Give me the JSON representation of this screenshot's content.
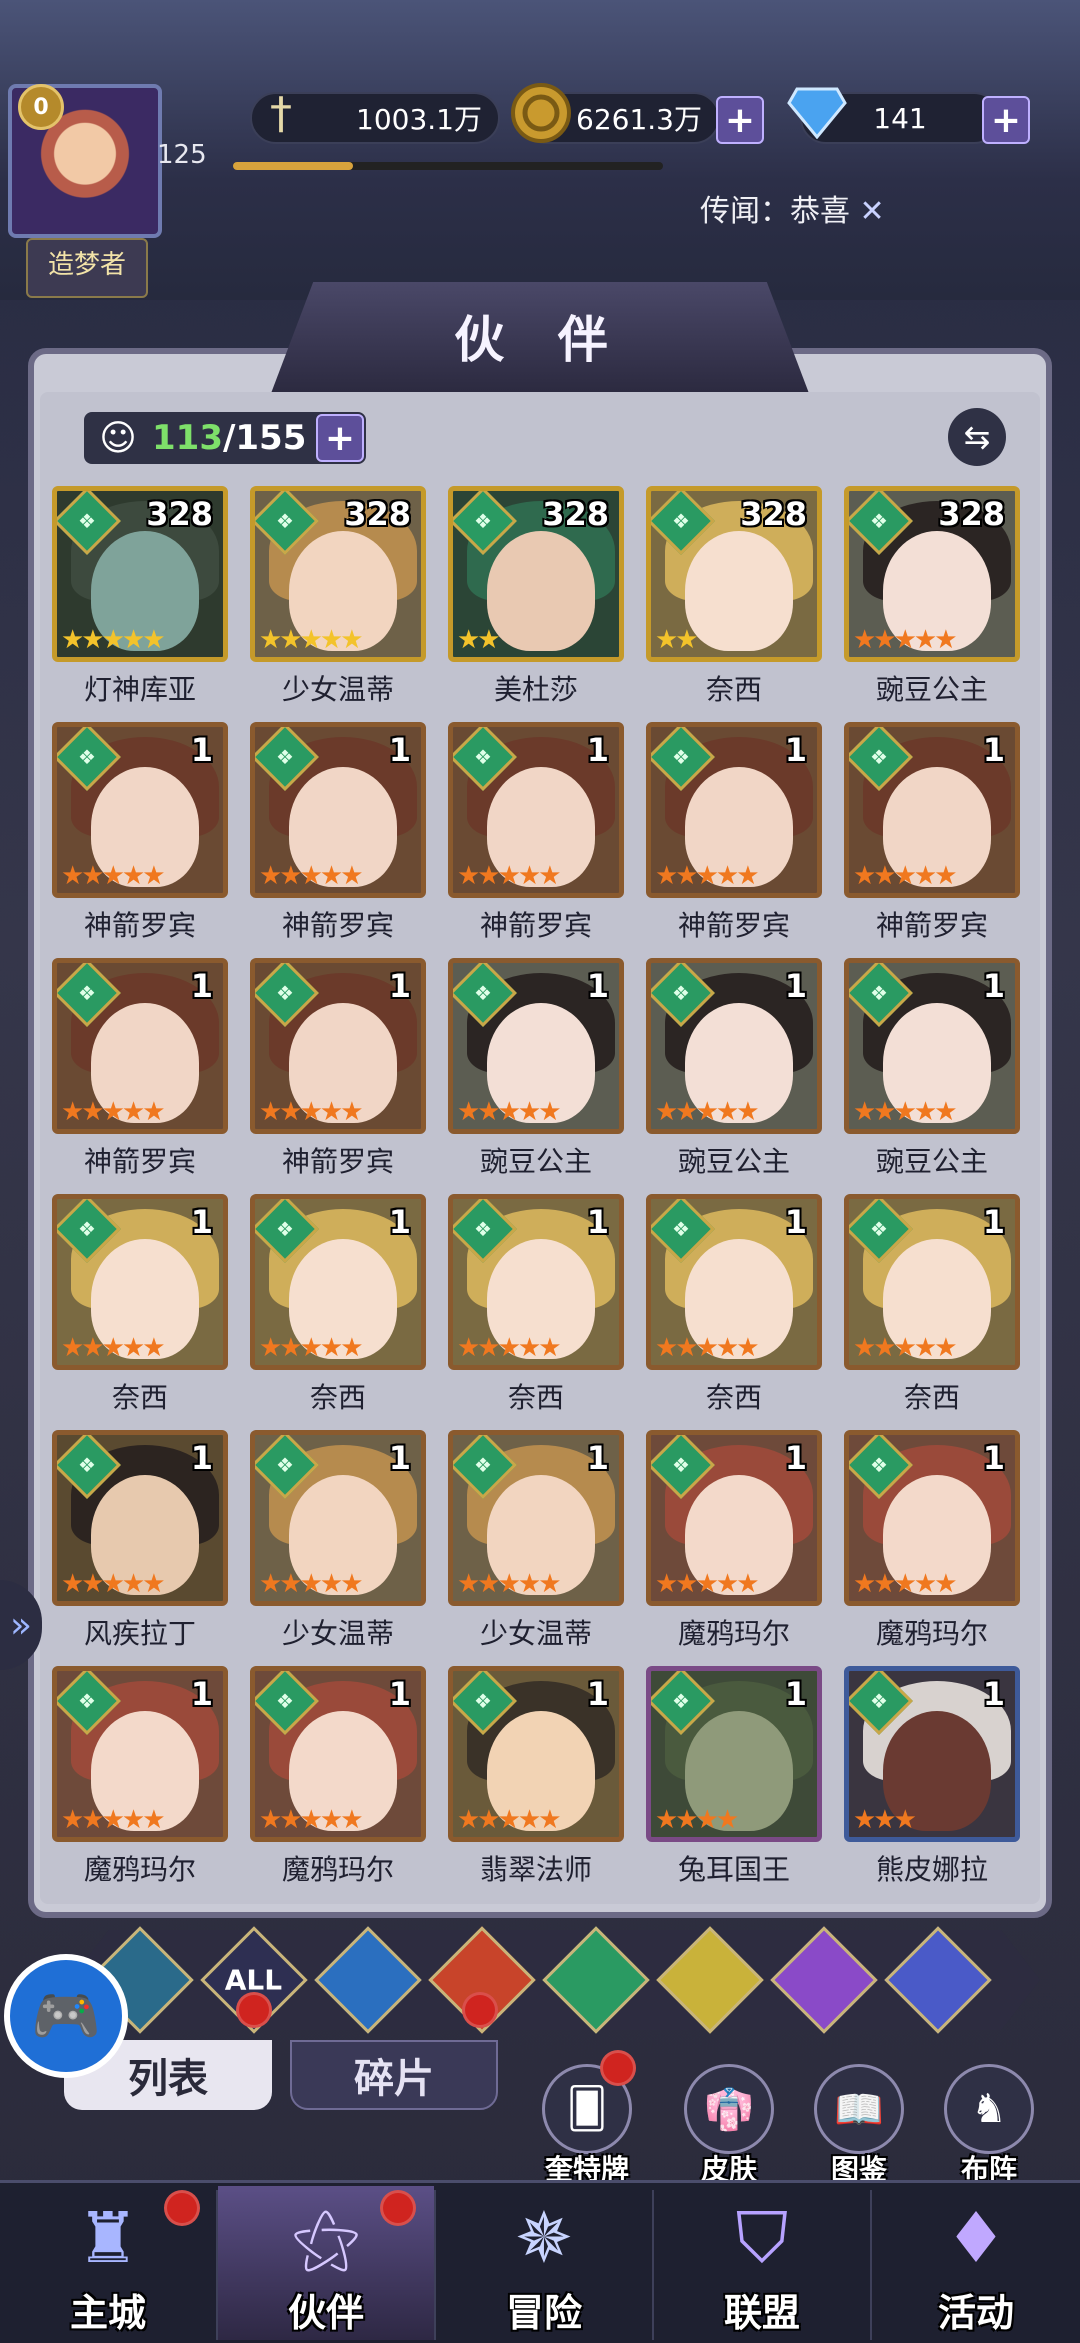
{
  "player": {
    "vip_level": "0",
    "level": "125",
    "title": "造梦者",
    "xp_fraction": 0.28
  },
  "resources": {
    "power": {
      "icon": "sword-icon",
      "value": "1003.1万"
    },
    "gold": {
      "icon": "gold-coin-icon",
      "value": "6261.3万"
    },
    "diamond": {
      "icon": "diamond-icon",
      "value": "141"
    }
  },
  "rumor": {
    "text": "传闻：恭喜"
  },
  "panel": {
    "title": "伙 伴"
  },
  "roster": {
    "current": "113",
    "max": "/155"
  },
  "heroes": [
    {
      "name": "灯神库亚",
      "level": "328",
      "stars": 5,
      "star_color": "#f3c32b",
      "frame": "#c59a2a",
      "hair": "#3d4a3e",
      "skin": "#7fa39a",
      "bg": "#2e3a2e"
    },
    {
      "name": "少女温蒂",
      "level": "328",
      "stars": 5,
      "star_color": "#f3c32b",
      "frame": "#c59a2a",
      "hair": "#b68b4e",
      "skin": "#f2d5c0",
      "bg": "#6e6148"
    },
    {
      "name": "美杜莎",
      "level": "328",
      "stars": 2,
      "star_color": "#f3c32b",
      "frame": "#c59a2a",
      "hair": "#2f6a4e",
      "skin": "#e9c9b2",
      "bg": "#2b4536"
    },
    {
      "name": "奈西",
      "level": "328",
      "stars": 2,
      "star_color": "#f3c32b",
      "frame": "#c59a2a",
      "hair": "#cfae5a",
      "skin": "#f6dfcf",
      "bg": "#7a6a42"
    },
    {
      "name": "豌豆公主",
      "level": "328",
      "stars": 5,
      "star_color": "#f0781f",
      "frame": "#c59a2a",
      "hair": "#2b2523",
      "skin": "#f3dfd6",
      "bg": "#5c5d52"
    },
    {
      "name": "神箭罗宾",
      "level": "1",
      "stars": 5,
      "star_color": "#f0781f",
      "frame": "#8a5a2e",
      "hair": "#6b3a2a",
      "skin": "#f1d6c6",
      "bg": "#6a4a33"
    },
    {
      "name": "神箭罗宾",
      "level": "1",
      "stars": 5,
      "star_color": "#f0781f",
      "frame": "#8a5a2e",
      "hair": "#6b3a2a",
      "skin": "#f1d6c6",
      "bg": "#6a4a33"
    },
    {
      "name": "神箭罗宾",
      "level": "1",
      "stars": 5,
      "star_color": "#f0781f",
      "frame": "#8a5a2e",
      "hair": "#6b3a2a",
      "skin": "#f1d6c6",
      "bg": "#6a4a33"
    },
    {
      "name": "神箭罗宾",
      "level": "1",
      "stars": 5,
      "star_color": "#f0781f",
      "frame": "#8a5a2e",
      "hair": "#6b3a2a",
      "skin": "#f1d6c6",
      "bg": "#6a4a33"
    },
    {
      "name": "神箭罗宾",
      "level": "1",
      "stars": 5,
      "star_color": "#f0781f",
      "frame": "#8a5a2e",
      "hair": "#6b3a2a",
      "skin": "#f1d6c6",
      "bg": "#6a4a33"
    },
    {
      "name": "神箭罗宾",
      "level": "1",
      "stars": 5,
      "star_color": "#f0781f",
      "frame": "#8a5a2e",
      "hair": "#6b3a2a",
      "skin": "#f1d6c6",
      "bg": "#6a4a33"
    },
    {
      "name": "神箭罗宾",
      "level": "1",
      "stars": 5,
      "star_color": "#f0781f",
      "frame": "#8a5a2e",
      "hair": "#6b3a2a",
      "skin": "#f1d6c6",
      "bg": "#6a4a33"
    },
    {
      "name": "豌豆公主",
      "level": "1",
      "stars": 5,
      "star_color": "#f0781f",
      "frame": "#8a5a2e",
      "hair": "#2b2523",
      "skin": "#f3dfd6",
      "bg": "#5c5d52"
    },
    {
      "name": "豌豆公主",
      "level": "1",
      "stars": 5,
      "star_color": "#f0781f",
      "frame": "#8a5a2e",
      "hair": "#2b2523",
      "skin": "#f3dfd6",
      "bg": "#5c5d52"
    },
    {
      "name": "豌豆公主",
      "level": "1",
      "stars": 5,
      "star_color": "#f0781f",
      "frame": "#8a5a2e",
      "hair": "#2b2523",
      "skin": "#f3dfd6",
      "bg": "#5c5d52"
    },
    {
      "name": "奈西",
      "level": "1",
      "stars": 5,
      "star_color": "#f0781f",
      "frame": "#8a5a2e",
      "hair": "#cfae5a",
      "skin": "#f6dfcf",
      "bg": "#7a6a42"
    },
    {
      "name": "奈西",
      "level": "1",
      "stars": 5,
      "star_color": "#f0781f",
      "frame": "#8a5a2e",
      "hair": "#cfae5a",
      "skin": "#f6dfcf",
      "bg": "#7a6a42"
    },
    {
      "name": "奈西",
      "level": "1",
      "stars": 5,
      "star_color": "#f0781f",
      "frame": "#8a5a2e",
      "hair": "#cfae5a",
      "skin": "#f6dfcf",
      "bg": "#7a6a42"
    },
    {
      "name": "奈西",
      "level": "1",
      "stars": 5,
      "star_color": "#f0781f",
      "frame": "#8a5a2e",
      "hair": "#cfae5a",
      "skin": "#f6dfcf",
      "bg": "#7a6a42"
    },
    {
      "name": "奈西",
      "level": "1",
      "stars": 5,
      "star_color": "#f0781f",
      "frame": "#8a5a2e",
      "hair": "#cfae5a",
      "skin": "#f6dfcf",
      "bg": "#7a6a42"
    },
    {
      "name": "风疾拉丁",
      "level": "1",
      "stars": 5,
      "star_color": "#f0781f",
      "frame": "#8a5a2e",
      "hair": "#2c2420",
      "skin": "#e7c9ae",
      "bg": "#5a4a30"
    },
    {
      "name": "少女温蒂",
      "level": "1",
      "stars": 5,
      "star_color": "#f0781f",
      "frame": "#8a5a2e",
      "hair": "#b68b4e",
      "skin": "#f2d5c0",
      "bg": "#6e6148"
    },
    {
      "name": "少女温蒂",
      "level": "1",
      "stars": 5,
      "star_color": "#f0781f",
      "frame": "#8a5a2e",
      "hair": "#b68b4e",
      "skin": "#f2d5c0",
      "bg": "#6e6148"
    },
    {
      "name": "魔鸦玛尔",
      "level": "1",
      "stars": 5,
      "star_color": "#f0781f",
      "frame": "#8a5a2e",
      "hair": "#9a4a3a",
      "skin": "#f3d9ca",
      "bg": "#6e4a3a"
    },
    {
      "name": "魔鸦玛尔",
      "level": "1",
      "stars": 5,
      "star_color": "#f0781f",
      "frame": "#8a5a2e",
      "hair": "#9a4a3a",
      "skin": "#f3d9ca",
      "bg": "#6e4a3a"
    },
    {
      "name": "魔鸦玛尔",
      "level": "1",
      "stars": 5,
      "star_color": "#f0781f",
      "frame": "#8a5a2e",
      "hair": "#9a4a3a",
      "skin": "#f3d9ca",
      "bg": "#6e4a3a"
    },
    {
      "name": "魔鸦玛尔",
      "level": "1",
      "stars": 5,
      "star_color": "#f0781f",
      "frame": "#8a5a2e",
      "hair": "#9a4a3a",
      "skin": "#f3d9ca",
      "bg": "#6e4a3a"
    },
    {
      "name": "翡翠法师",
      "level": "1",
      "stars": 5,
      "star_color": "#f0781f",
      "frame": "#8a5a2e",
      "hair": "#3a3228",
      "skin": "#f2d3b4",
      "bg": "#6a5a3a"
    },
    {
      "name": "兔耳国王",
      "level": "1",
      "stars": 4,
      "star_color": "#f0781f",
      "frame": "#7a4a86",
      "hair": "#4a5a3e",
      "skin": "#8f9a7a",
      "bg": "#3e4a38"
    },
    {
      "name": "熊皮娜拉",
      "level": "1",
      "stars": 3,
      "star_color": "#f0781f",
      "frame": "#3e5a9a",
      "hair": "#d8d2cf",
      "skin": "#6a3a32",
      "bg": "#3a3540"
    }
  ],
  "filters": [
    {
      "label": "",
      "icon": "all-faction-icon",
      "color": "#2a6a8a"
    },
    {
      "label": "ALL",
      "icon": "all-icon",
      "color": "#2e2f52"
    },
    {
      "label": "",
      "icon": "water-icon",
      "color": "#2b6fbf"
    },
    {
      "label": "",
      "icon": "fire-icon",
      "color": "#c8442a"
    },
    {
      "label": "",
      "icon": "wind-icon",
      "color": "#2a9a62"
    },
    {
      "label": "",
      "icon": "light-icon",
      "color": "#c9b23a"
    },
    {
      "label": "",
      "icon": "moon-icon",
      "color": "#8a4ac8"
    },
    {
      "label": "",
      "icon": "planet-icon",
      "color": "#4a5ac8"
    }
  ],
  "tabs": {
    "list": "列表",
    "shards": "碎片"
  },
  "sub_buttons": {
    "quest_cards": "奎特牌",
    "skins": "皮肤",
    "codex": "图鉴",
    "formation": "布阵"
  },
  "nav": {
    "city": "主城",
    "partners": "伙伴",
    "adventure": "冒险",
    "alliance": "联盟",
    "events": "活动"
  }
}
